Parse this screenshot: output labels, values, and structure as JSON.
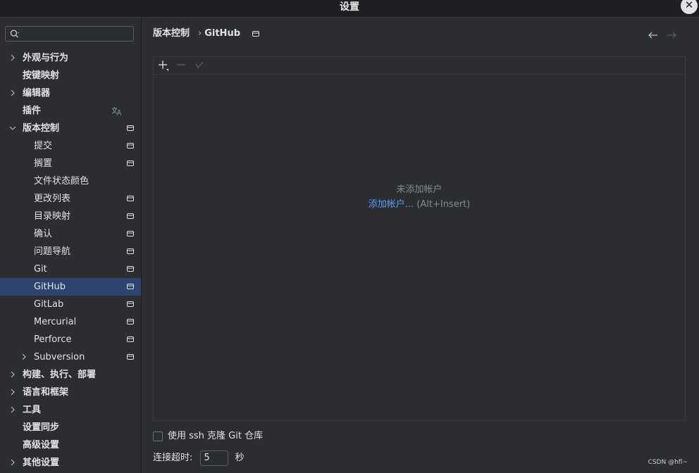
{
  "window": {
    "title": "设置",
    "close_label": "✕"
  },
  "sidebar": {
    "items": [
      {
        "label": "外观与行为",
        "level": 0,
        "bold": true,
        "chevron": "right"
      },
      {
        "label": "按键映射",
        "level": 0,
        "bold": true,
        "chevron": ""
      },
      {
        "label": "编辑器",
        "level": 0,
        "bold": true,
        "chevron": "right"
      },
      {
        "label": "插件",
        "level": 0,
        "bold": true,
        "chevron": "",
        "translate": true
      },
      {
        "label": "版本控制",
        "level": 0,
        "bold": true,
        "chevron": "down",
        "badge": true
      },
      {
        "label": "提交",
        "level": 1,
        "badge": true
      },
      {
        "label": "搁置",
        "level": 1,
        "badge": true
      },
      {
        "label": "文件状态颜色",
        "level": 1
      },
      {
        "label": "更改列表",
        "level": 1,
        "badge": true
      },
      {
        "label": "目录映射",
        "level": 1,
        "badge": true
      },
      {
        "label": "确认",
        "level": 1,
        "badge": true
      },
      {
        "label": "问题导航",
        "level": 1,
        "badge": true
      },
      {
        "label": "Git",
        "level": 1,
        "badge": true
      },
      {
        "label": "GitHub",
        "level": 1,
        "badge": true,
        "selected": true
      },
      {
        "label": "GitLab",
        "level": 1,
        "badge": true
      },
      {
        "label": "Mercurial",
        "level": 1,
        "badge": true
      },
      {
        "label": "Perforce",
        "level": 1,
        "badge": true
      },
      {
        "label": "Subversion",
        "level": 1,
        "badge": true,
        "chevron": "right"
      },
      {
        "label": "构建、执行、部署",
        "level": 0,
        "bold": true,
        "chevron": "right"
      },
      {
        "label": "语言和框架",
        "level": 0,
        "bold": true,
        "chevron": "right"
      },
      {
        "label": "工具",
        "level": 0,
        "bold": true,
        "chevron": "right"
      },
      {
        "label": "设置同步",
        "level": 0,
        "bold": true
      },
      {
        "label": "高级设置",
        "level": 0,
        "bold": true
      },
      {
        "label": "其他设置",
        "level": 0,
        "bold": true,
        "chevron": "right"
      }
    ]
  },
  "breadcrumb": {
    "parent": "版本控制",
    "separator": "›",
    "current": "GitHub"
  },
  "accounts_panel": {
    "empty_title": "未添加帐户",
    "add_link": "添加帐户...",
    "add_hint": "(Alt+Insert)"
  },
  "options": {
    "ssh_clone_label": "使用 ssh 克隆 Git 仓库",
    "ssh_clone_checked": false,
    "timeout_label": "连接超时:",
    "timeout_value": "5",
    "timeout_unit": "秒"
  },
  "watermark": "CSDN @hfl~",
  "colors": {
    "selection": "#2e436e",
    "link": "#589df6",
    "background": "#2b2d30"
  }
}
